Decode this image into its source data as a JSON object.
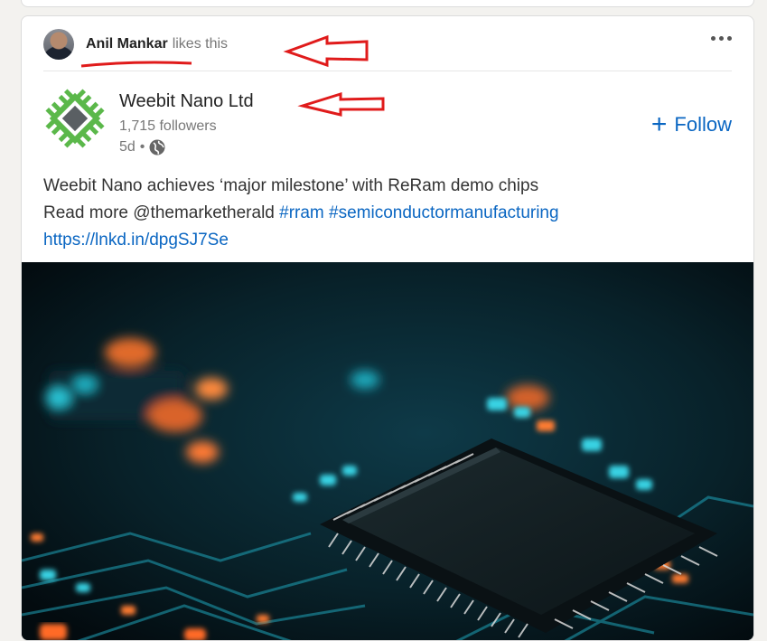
{
  "social": {
    "actor_name": "Anil Mankar",
    "action_text": "likes this"
  },
  "company": {
    "name": "Weebit Nano Ltd",
    "followers": "1,715 followers",
    "age": "5d",
    "separator": "•",
    "follow_label": "Follow",
    "follow_plus": "+"
  },
  "post": {
    "line1": "Weebit Nano achieves ‘major milestone’ with ReRam demo chips",
    "read_more": "Read more @themarketherald",
    "hashtag1": "#rram",
    "hashtag2": "#semiconductormanufacturing",
    "link": "https://lnkd.in/dpgSJ7Se"
  },
  "colors": {
    "accent": "#0a66c2",
    "annotation": "#e01b1b",
    "logo_green": "#5bb84a",
    "logo_gray": "#5a5f63"
  },
  "icons": [
    "more-options-icon",
    "globe-icon",
    "plus-icon",
    "arrow-icon"
  ]
}
